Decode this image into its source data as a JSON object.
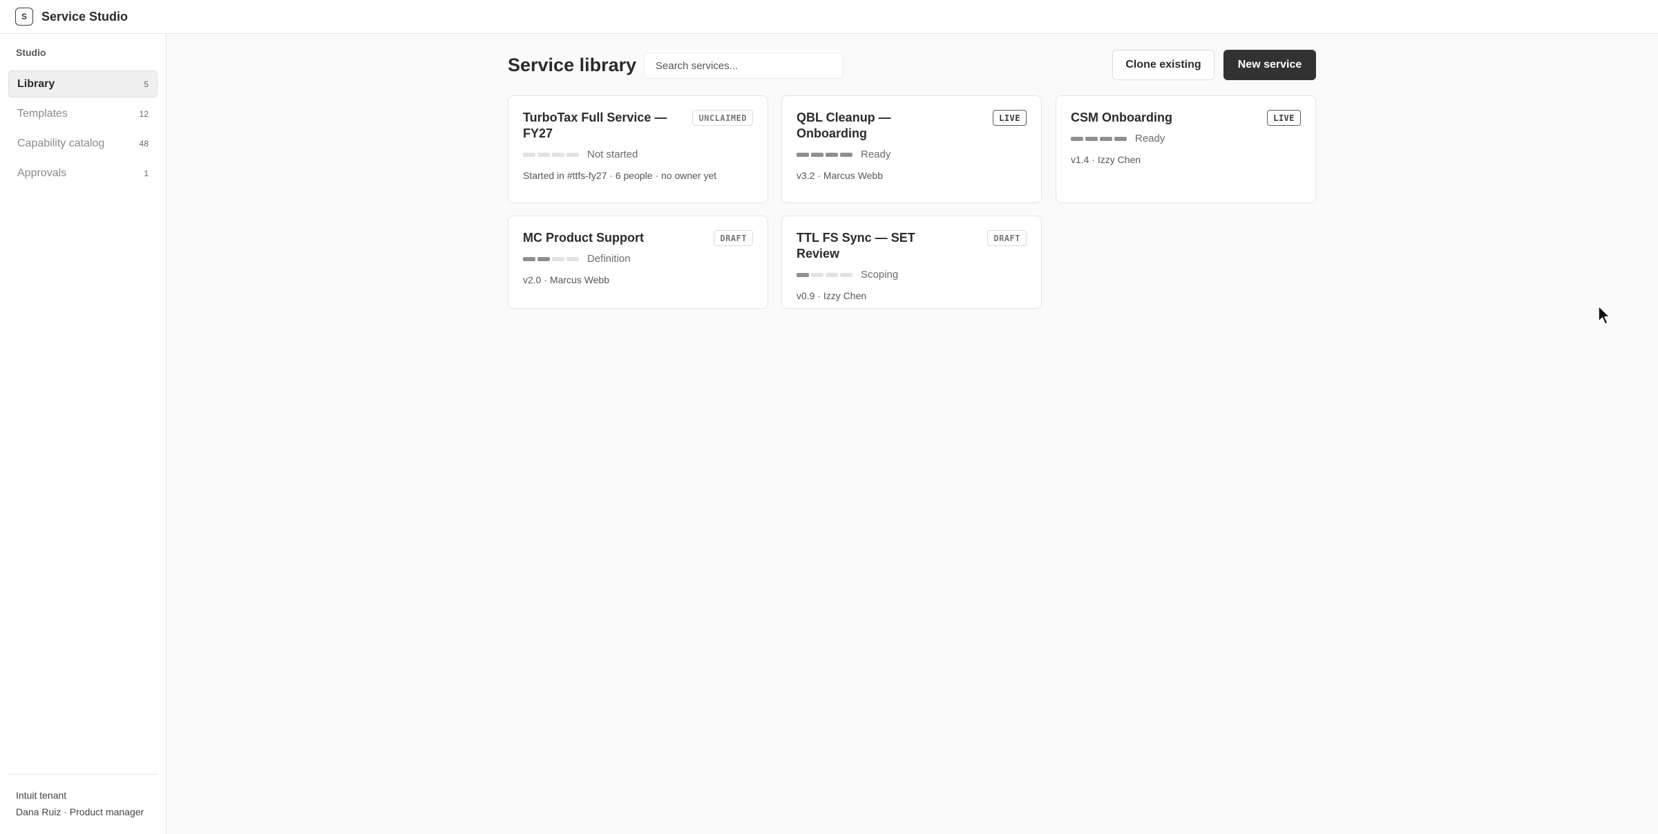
{
  "app": {
    "logo_letter": "S",
    "title": "Service Studio"
  },
  "sidebar": {
    "section": "Studio",
    "items": [
      {
        "label": "Library",
        "count": "5"
      },
      {
        "label": "Templates",
        "count": "12"
      },
      {
        "label": "Capability catalog",
        "count": "48"
      },
      {
        "label": "Approvals",
        "count": "1"
      }
    ],
    "footer": {
      "tenant": "Intuit tenant",
      "user": "Dana Ruiz · Product manager"
    }
  },
  "main": {
    "title": "Service library",
    "search_placeholder": "Search services...",
    "clone_label": "Clone existing",
    "new_label": "New service",
    "cards": [
      {
        "title": "TurboTax Full Service — FY27",
        "badge": "UNCLAIMED",
        "progress_filled": 0,
        "progress_total": 4,
        "stage": "Not started",
        "meta": "Started in #ttfs-fy27 · 6 people · no owner yet"
      },
      {
        "title": "QBL Cleanup — Onboarding",
        "badge": "LIVE",
        "progress_filled": 4,
        "progress_total": 4,
        "stage": "Ready",
        "meta": "v3.2 · Marcus Webb"
      },
      {
        "title": "CSM Onboarding",
        "badge": "LIVE",
        "progress_filled": 4,
        "progress_total": 4,
        "stage": "Ready",
        "meta": "v1.4 · Izzy Chen"
      },
      {
        "title": "MC Product Support",
        "badge": "DRAFT",
        "progress_filled": 2,
        "progress_total": 4,
        "stage": "Definition",
        "meta": "v2.0 · Marcus Webb"
      },
      {
        "title": "TTL FS Sync — SET Review",
        "badge": "DRAFT",
        "progress_filled": 1,
        "progress_total": 4,
        "stage": "Scoping",
        "meta": "v0.9 · Izzy Chen"
      }
    ]
  }
}
